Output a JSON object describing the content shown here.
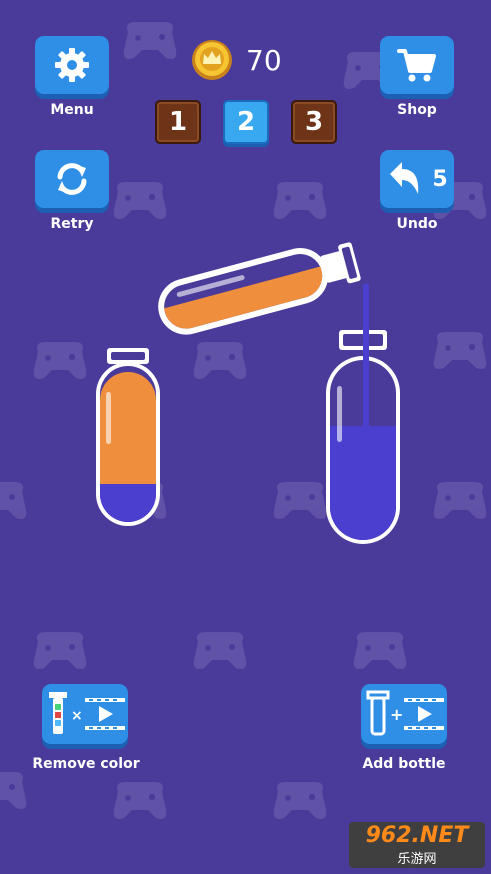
{
  "header": {
    "coins": "70",
    "levels": [
      {
        "label": "1",
        "state": "locked"
      },
      {
        "label": "2",
        "state": "current"
      },
      {
        "label": "3",
        "state": "locked"
      }
    ]
  },
  "buttons": {
    "menu_label": "Menu",
    "shop_label": "Shop",
    "retry_label": "Retry",
    "undo_label": "Undo",
    "undo_count": "5",
    "remove_color_label": "Remove color",
    "add_bottle_label": "Add bottle"
  },
  "watermark": {
    "brand": "962.NET",
    "sub": "乐游网"
  },
  "icons": [
    "gear-icon",
    "cart-icon",
    "refresh-icon",
    "undo-arrow-icon",
    "coin-crown-icon",
    "video-ad-icon",
    "tube-icon"
  ],
  "colors": {
    "background": "#4a3a9a",
    "button": "#2f8fe6",
    "orange_liquid": "#ef8f3d",
    "blue_liquid": "#4a3fcf"
  }
}
